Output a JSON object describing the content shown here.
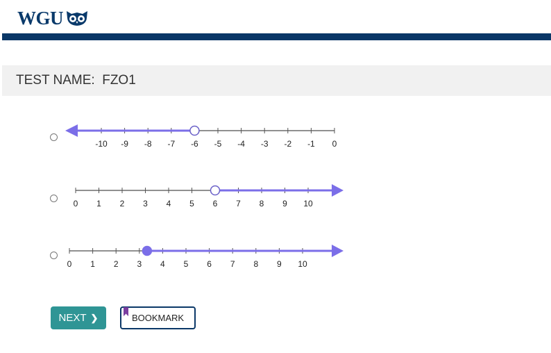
{
  "header": {
    "logo_text": "WGU",
    "logo_icon": "owl-icon",
    "brand_color": "#0a3767"
  },
  "test": {
    "label": "TEST NAME:  FZO1"
  },
  "options": [
    {
      "ticks": [
        "-10",
        "-9",
        "-8",
        "-7",
        "-6",
        "-5",
        "-4",
        "-3",
        "-2",
        "-1",
        "0"
      ],
      "point_value": -6,
      "point_type": "open",
      "ray_direction": "left"
    },
    {
      "ticks": [
        "0",
        "1",
        "2",
        "3",
        "4",
        "5",
        "6",
        "7",
        "8",
        "9",
        "10"
      ],
      "point_value": 6,
      "point_type": "open",
      "ray_direction": "right"
    },
    {
      "ticks": [
        "0",
        "1",
        "2",
        "3",
        "4",
        "5",
        "6",
        "7",
        "8",
        "9",
        "10"
      ],
      "point_value": 3.33,
      "point_type": "closed",
      "ray_direction": "right"
    }
  ],
  "actions": {
    "next_label": "NEXT",
    "next_icon": "chevron-right-icon",
    "bookmark_label": "BOOKMARK",
    "bookmark_icon": "bookmark-icon"
  },
  "colors": {
    "accent_teal": "#2f9595",
    "ray_color": "#7b6ee8",
    "test_bar_bg": "#f1f1f1"
  }
}
